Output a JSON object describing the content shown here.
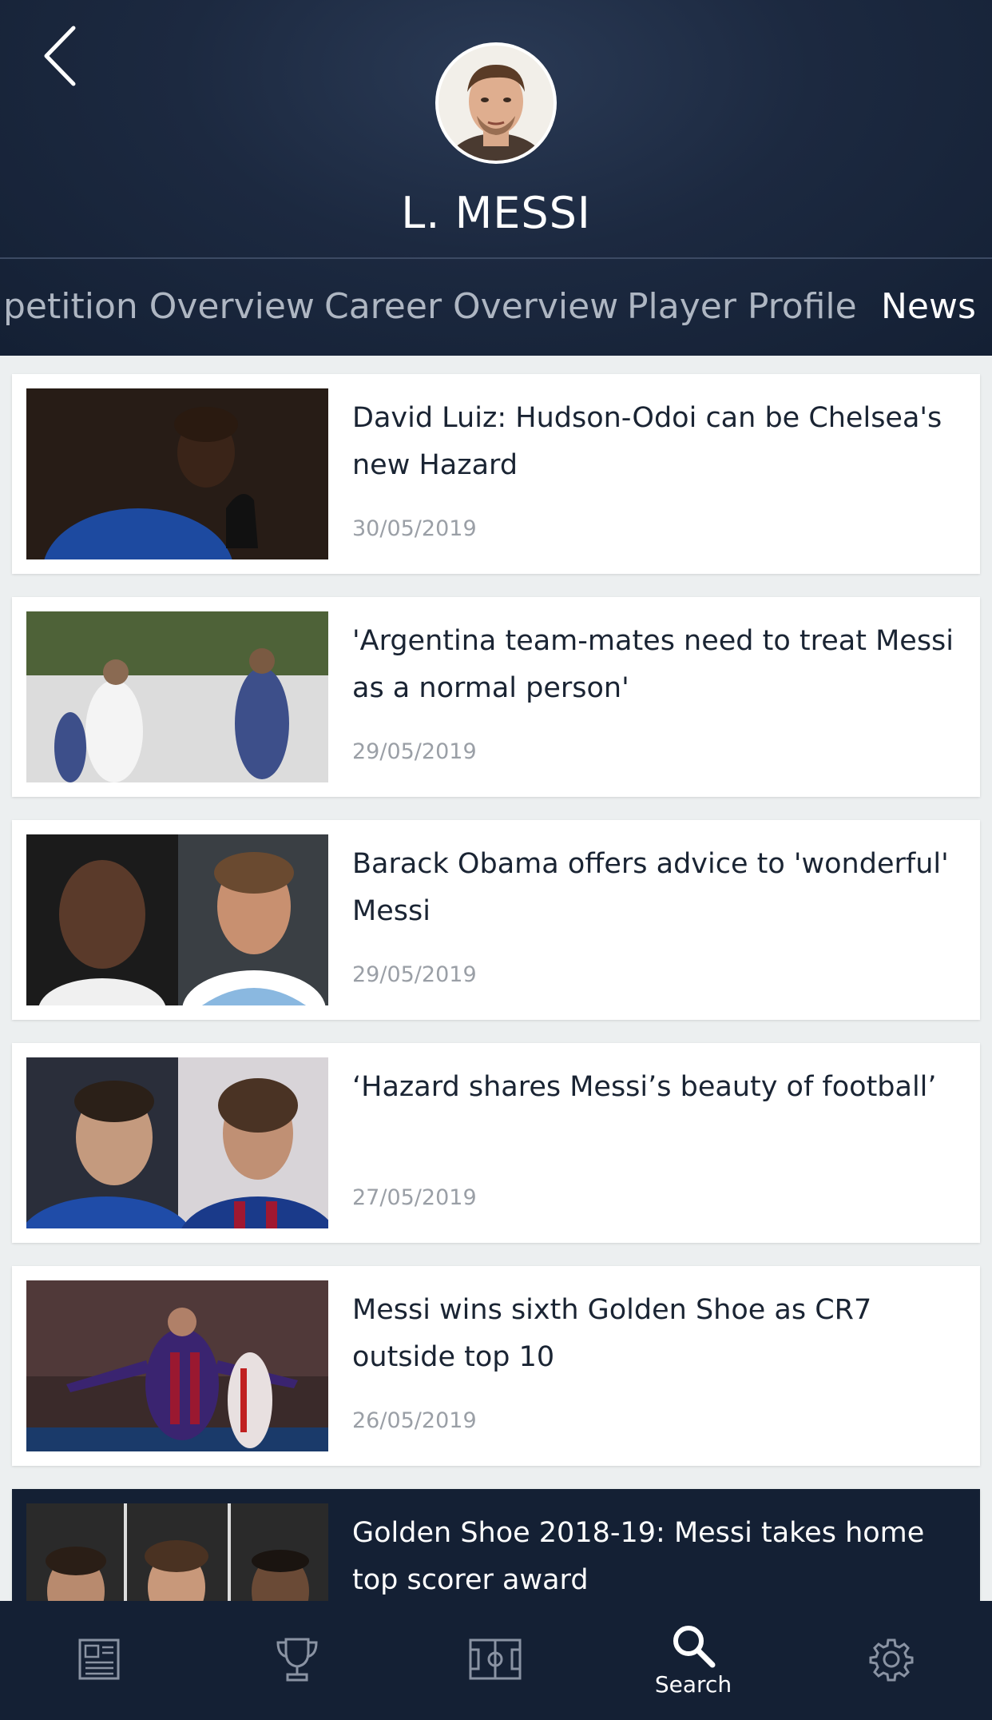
{
  "header": {
    "player_name": "L. MESSI",
    "tabs": [
      {
        "label": "petition Overview",
        "active": false
      },
      {
        "label": "Career Overview",
        "active": false
      },
      {
        "label": "Player Profile",
        "active": false
      },
      {
        "label": "News",
        "active": true
      }
    ]
  },
  "news": [
    {
      "title": "David Luiz: Hudson-Odoi can be Chelsea's new Hazard",
      "date": "30/05/2019"
    },
    {
      "title": "'Argentina team-mates need to treat Messi as a normal person'",
      "date": "29/05/2019"
    },
    {
      "title": "Barack Obama offers advice to 'wonderful' Messi",
      "date": "29/05/2019"
    },
    {
      "title": "‘Hazard shares Messi’s beauty of football’",
      "date": "27/05/2019"
    },
    {
      "title": "Messi wins sixth Golden Shoe as CR7 outside top 10",
      "date": "26/05/2019"
    },
    {
      "title": "Golden Shoe 2018-19: Messi takes home top scorer award",
      "date": ""
    }
  ],
  "bottom_nav": {
    "items": [
      {
        "icon": "news-icon",
        "label": ""
      },
      {
        "icon": "trophy-icon",
        "label": ""
      },
      {
        "icon": "pitch-icon",
        "label": ""
      },
      {
        "icon": "search-icon",
        "label": "Search",
        "active": true
      },
      {
        "icon": "gear-icon",
        "label": ""
      }
    ]
  },
  "colors": {
    "header_bg": "#1c2940",
    "nav_bg": "#142034",
    "list_bg": "#eceff0",
    "title_text": "#1a2433",
    "date_text": "#9a9fa6",
    "tab_inactive": "#aeb6c2"
  }
}
